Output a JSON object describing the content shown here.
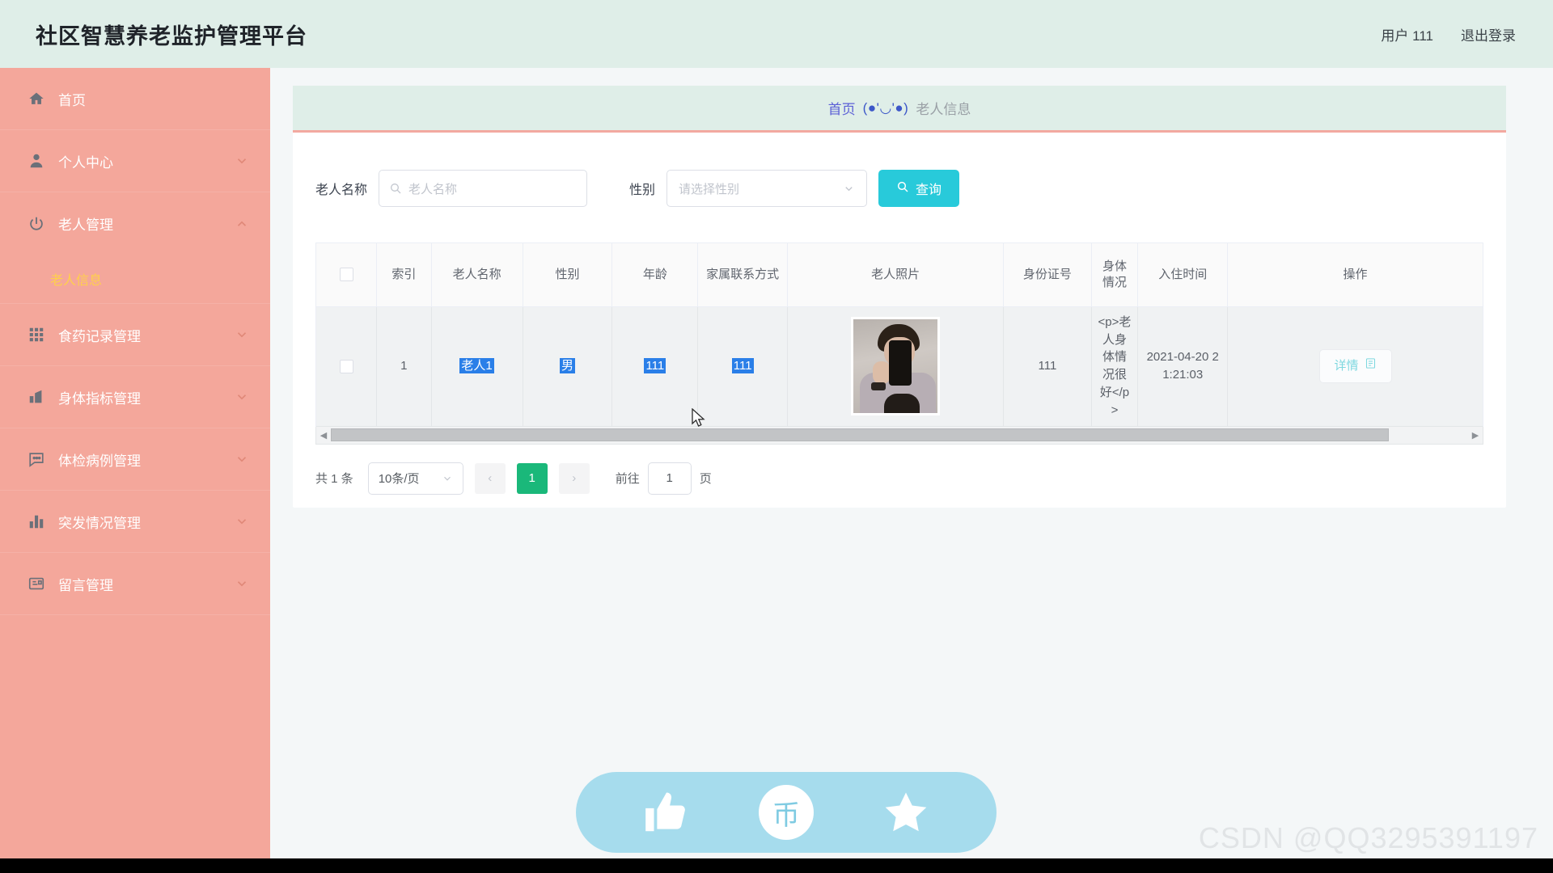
{
  "topbar": {
    "title": "社区智慧养老监护管理平台",
    "user_label": "用户 111",
    "logout_label": "退出登录"
  },
  "sidebar": {
    "items": [
      {
        "label": "首页",
        "icon": "home-icon",
        "arrow": "none",
        "active": false
      },
      {
        "label": "个人中心",
        "icon": "user-icon",
        "arrow": "down",
        "active": false
      },
      {
        "label": "老人管理",
        "icon": "power-icon",
        "arrow": "up",
        "active": true
      },
      {
        "label": "食药记录管理",
        "icon": "grid-icon",
        "arrow": "down",
        "active": false
      },
      {
        "label": "身体指标管理",
        "icon": "chart-up-icon",
        "arrow": "down",
        "active": false
      },
      {
        "label": "体检病例管理",
        "icon": "comment-icon",
        "arrow": "down",
        "active": false
      },
      {
        "label": "突发情况管理",
        "icon": "bar-chart-icon",
        "arrow": "down",
        "active": false
      },
      {
        "label": "留言管理",
        "icon": "message-icon",
        "arrow": "down",
        "active": false
      }
    ],
    "submenu": {
      "label": "老人信息",
      "active": true
    }
  },
  "breadcrumb": {
    "home": "首页",
    "separator": "(●'◡'●)",
    "current": "老人信息"
  },
  "search": {
    "name_label": "老人名称",
    "name_placeholder": "老人名称",
    "name_value": "",
    "gender_label": "性别",
    "gender_placeholder": "请选择性别",
    "gender_value": "",
    "query_button": "查询",
    "search_icon": "search-icon"
  },
  "table": {
    "headers": [
      "",
      "索引",
      "老人名称",
      "性别",
      "年龄",
      "家属联系方式",
      "老人照片",
      "身份证号",
      "身体情况",
      "入住时间",
      "操作"
    ],
    "rows": [
      {
        "index": "1",
        "name": "老人1",
        "gender": "男",
        "age": "111",
        "family_contact": "111",
        "photo_alt": "老人照片",
        "id_number": "111",
        "health": "<p>老人身体情况很好</p>",
        "checkin_time": "2021-04-20 21:21:03",
        "action_label": "详情"
      }
    ]
  },
  "pagination": {
    "total_label": "共 1 条",
    "page_size": "10条/页",
    "prev": "‹",
    "next": "›",
    "current_page": "1",
    "jump_label": "前往",
    "jump_value": "1",
    "jump_unit": "页"
  },
  "float_bar": {
    "like_icon": "thumbs-up-icon",
    "coin_icon": "coin-icon",
    "coin_text": "币",
    "star_icon": "star-icon"
  },
  "watermark": "CSDN @QQ3295391197"
}
